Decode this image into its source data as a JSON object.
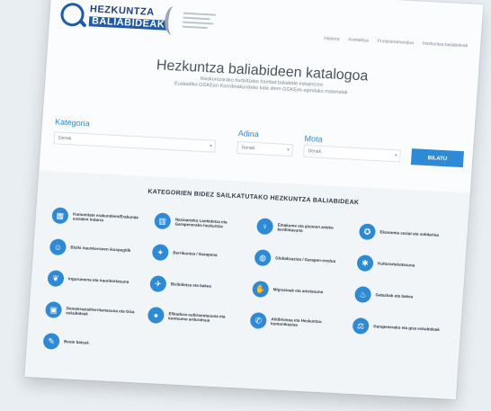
{
  "header": {
    "logo_line1": "HEZKUNTZA",
    "logo_line2": "BALIABIDEAK",
    "nav": [
      "Hasiera",
      "Kontaktua",
      "Funtzionamendua",
      "Hezkuntza baliabideak"
    ]
  },
  "hero": {
    "title": "Hezkuntza baliabideen katalogoa",
    "subtitle_1": "Ikaskuntzarako hurbiltzeko hainbat baliabide eskaintzen",
    "subtitle_2": "Euskadiko GGKEen Koordinakundeko kide diren GGKEek egindako materialak"
  },
  "filters": {
    "category_label": "Kategoria",
    "age_label": "Adina",
    "subject_label": "Mota",
    "category_value": "Denak",
    "age_value": "Denak",
    "subject_value": "Denak",
    "search_label": "BILATU"
  },
  "categories_title": "KATEGORIEN BIDEZ SAILKATUTAKO HEZKUNTZA BALIABIDEAK",
  "categories": [
    {
      "icon": "building-icon",
      "glyph": "▦",
      "label": "Komunitate erakundeen/Erakunde sozialen indarra"
    },
    {
      "icon": "people-icon",
      "glyph": "☺",
      "label": "Biziki iraunkorraren ikuspegitik"
    },
    {
      "icon": "leaf-icon",
      "glyph": "❦",
      "label": "Ingurumena eta iraunkortasuna"
    },
    {
      "icon": "school-icon",
      "glyph": "▣",
      "label": "Demokrazia/Herritartasuna eta Giza eskubideak"
    },
    {
      "icon": "bank-icon",
      "glyph": "▥",
      "label": "Nazioarteko Lankidetza eta Garapenerako hezkuntza"
    },
    {
      "icon": "bulb-icon",
      "glyph": "✦",
      "label": "Berrikuntza / Garapena"
    },
    {
      "icon": "dove-icon",
      "glyph": "✈",
      "label": "Bizikidetza eta bakea"
    },
    {
      "icon": "apple-icon",
      "glyph": "●",
      "label": "Elikadura-subiranotasuna eta kontsumo arduratsua"
    },
    {
      "icon": "venus-icon",
      "glyph": "♀",
      "label": "Emakume eta gizonen arteko berdintasuna"
    },
    {
      "icon": "globe-icon",
      "glyph": "◍",
      "label": "Globalizazioa / Garapen-eredua"
    },
    {
      "icon": "handshake-icon",
      "glyph": "✋",
      "label": "Migrazioak eta aniztasuna"
    },
    {
      "icon": "megaphone-icon",
      "glyph": "✆",
      "label": "Aktibismoa eta Hezkuntza-komunikazioa"
    },
    {
      "icon": "medal-icon",
      "glyph": "✪",
      "label": "Ekonomia sozial eta solidarioa"
    },
    {
      "icon": "gear-icon",
      "glyph": "✱",
      "label": "Kulturartekotasuna"
    },
    {
      "icon": "fire-icon",
      "glyph": "♨",
      "label": "Gatazkak eta bakea"
    },
    {
      "icon": "scales-icon",
      "glyph": "⚖",
      "label": "Garapenerako eta giza eskubideak"
    },
    {
      "icon": "scroll-icon",
      "glyph": "✎",
      "label": "Beste batzuk"
    }
  ]
}
